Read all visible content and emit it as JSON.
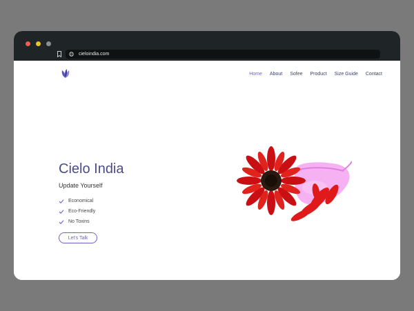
{
  "browser": {
    "url": "cieloindia.com",
    "icons": [
      "bookmark-icon",
      "globe-icon"
    ]
  },
  "site": {
    "logo_icon": "lotus-logo-icon",
    "nav": [
      "Home",
      "About",
      "Sofee",
      "Product",
      "Size Guide",
      "Contact"
    ],
    "active_nav": "Home"
  },
  "hero": {
    "title": "Cielo India",
    "subtitle": "Update Yourself",
    "features": [
      "Economical",
      "Eco-Friendly",
      "No Toxins"
    ],
    "cta_label": "Let's Talk",
    "image_icon": "flower-and-menstrual-cup-image"
  },
  "colors": {
    "accent": "#6b63c9",
    "heading": "#4a4d85",
    "backdrop": "#7a7a7a",
    "browser_chrome": "#1f2426"
  }
}
